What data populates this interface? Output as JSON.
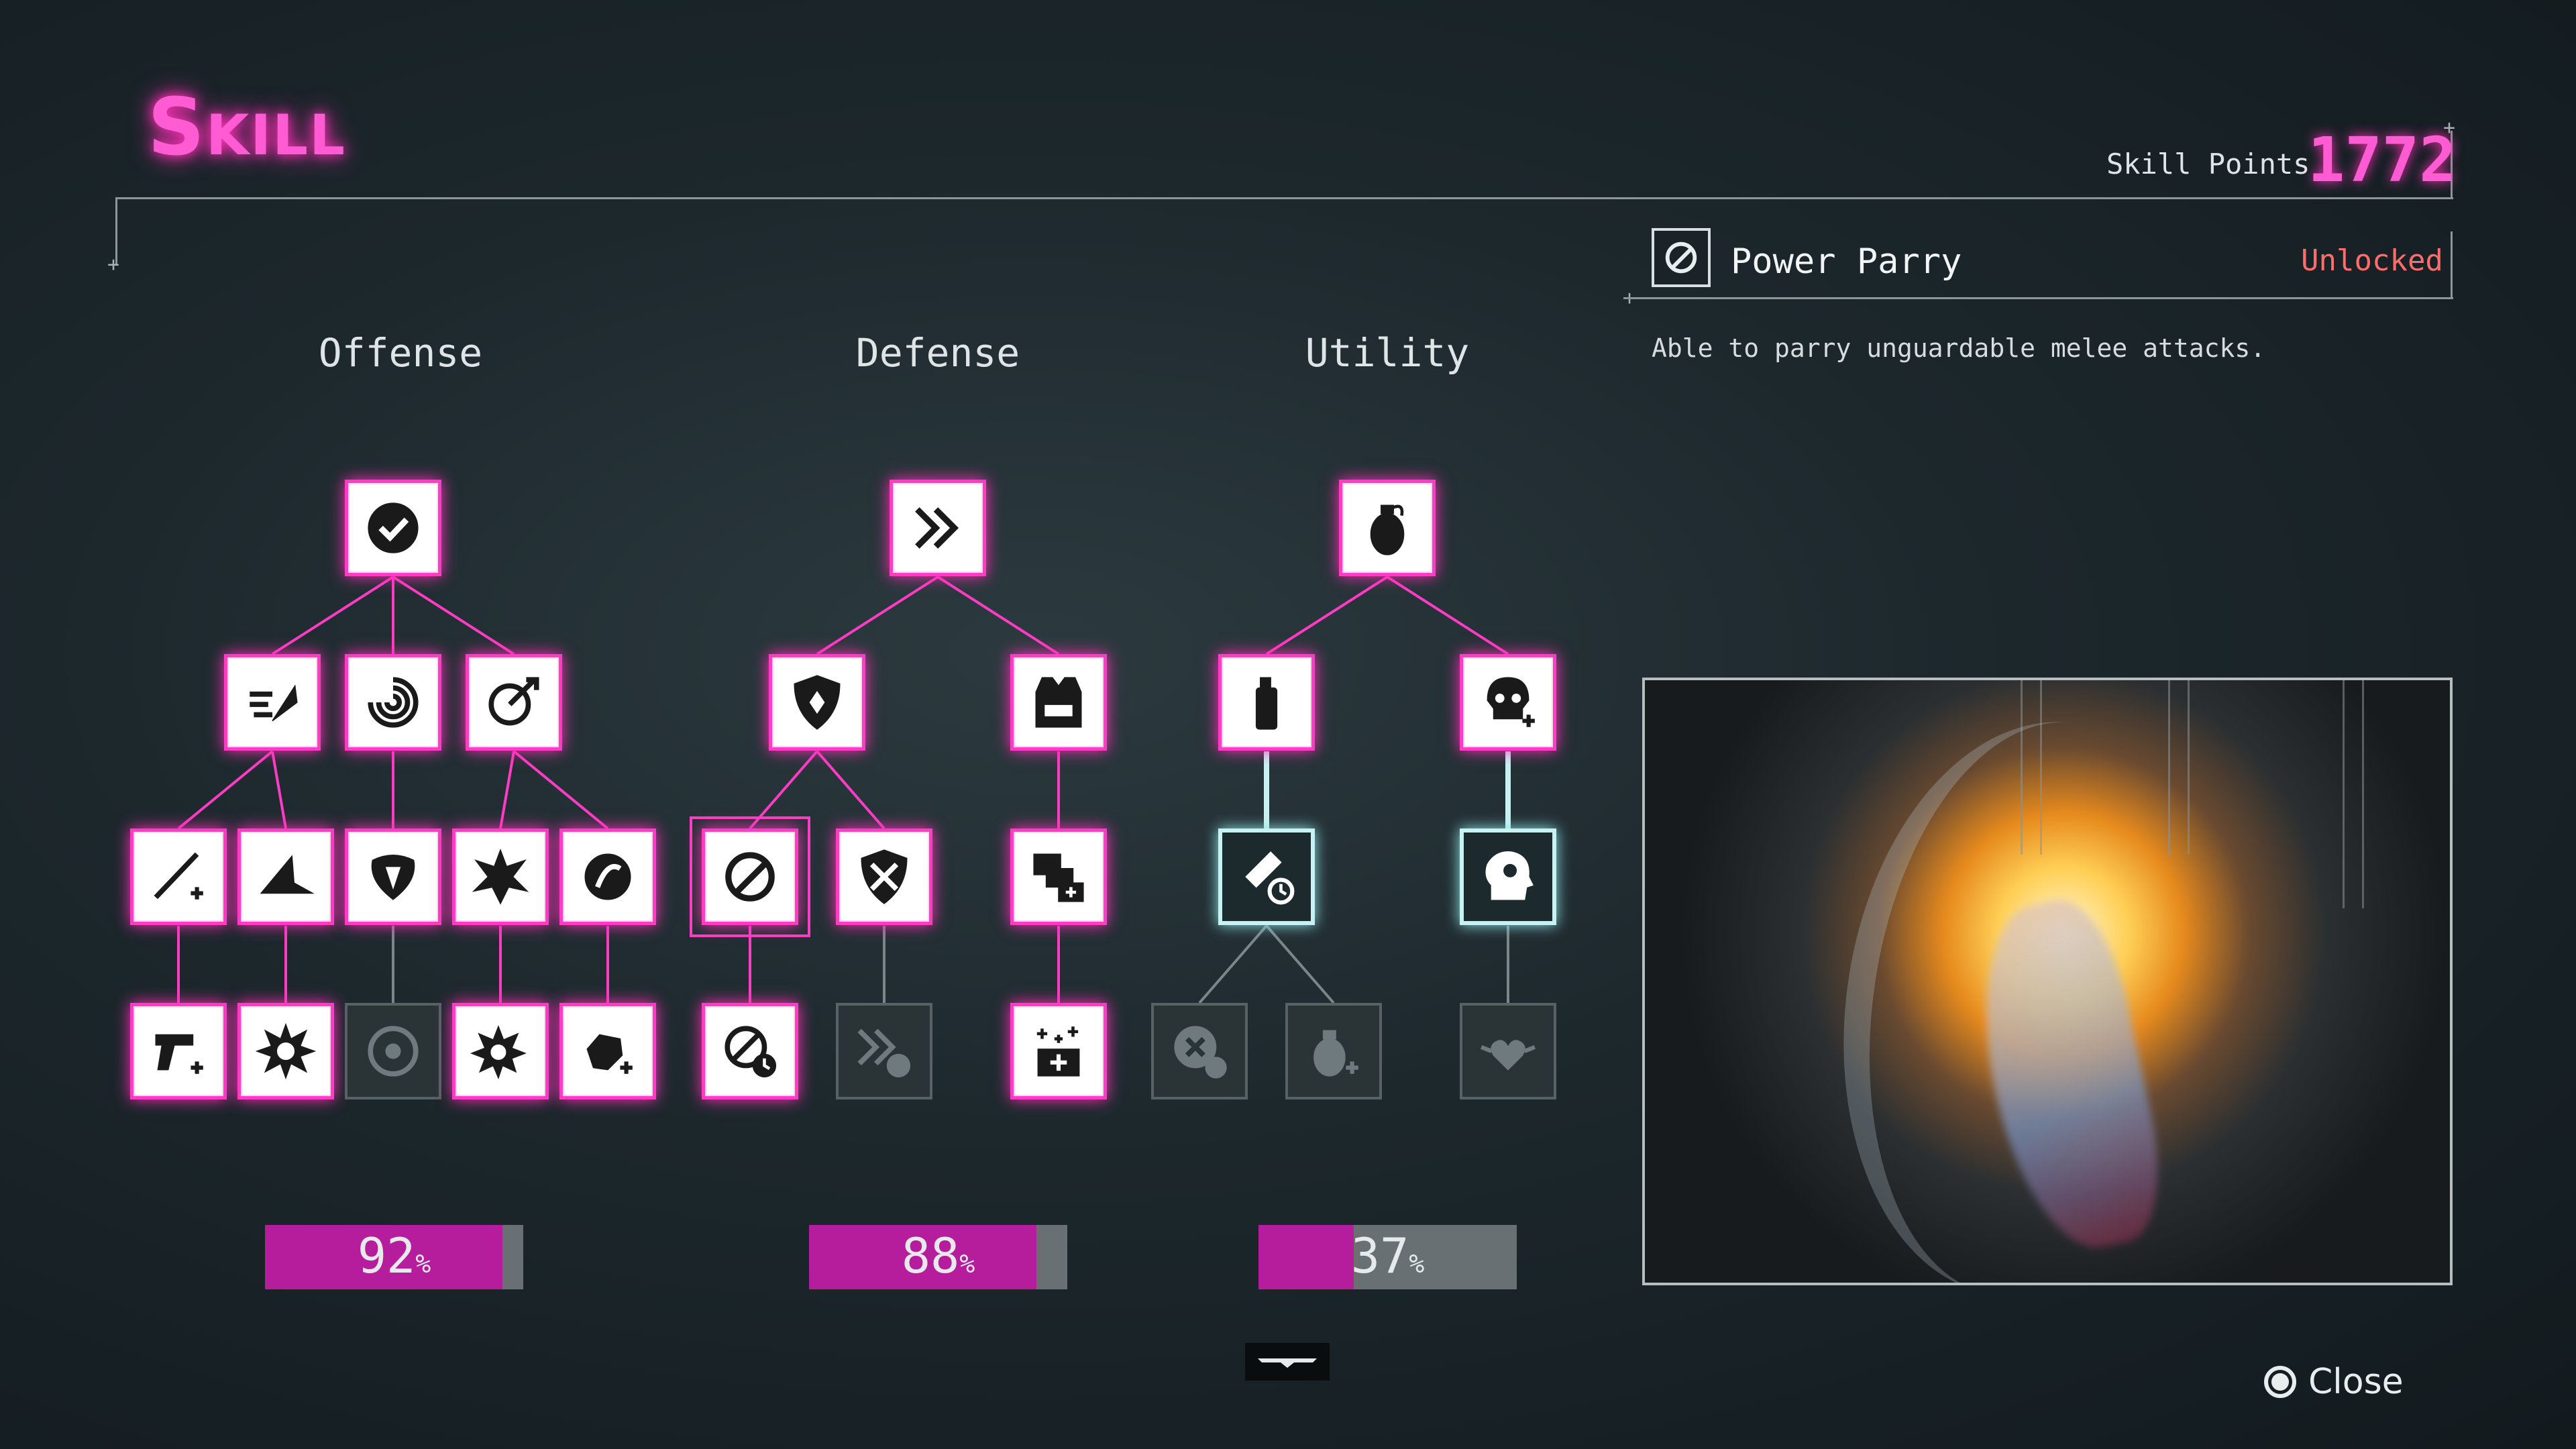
{
  "header": {
    "title": "Skill",
    "skill_points_label": "Skill Points",
    "skill_points_value": "1772"
  },
  "selected_skill": {
    "name": "Power Parry",
    "status": "Unlocked",
    "description": "Able to parry unguardable melee attacks.",
    "icon": "parry-icon"
  },
  "colors": {
    "accent": "#ff3cc4",
    "bar_fill": "#b51d9d",
    "status_unlocked": "#ff6c6c"
  },
  "categories": [
    {
      "name": "Offense",
      "completion": "92",
      "completion_fraction": 0.92,
      "unit": "%"
    },
    {
      "name": "Defense",
      "completion": "88",
      "completion_fraction": 0.88,
      "unit": "%"
    },
    {
      "name": "Utility",
      "completion": "37",
      "completion_fraction": 0.37,
      "unit": "%"
    }
  ],
  "skill_nodes": [
    {
      "id": "off-root",
      "icon": "checkmark-icon",
      "state": "on"
    },
    {
      "id": "off-a",
      "icon": "dash-slash-icon",
      "state": "on"
    },
    {
      "id": "off-b",
      "icon": "swirl-icon",
      "state": "on"
    },
    {
      "id": "off-c",
      "icon": "target-arrow-icon",
      "state": "on"
    },
    {
      "id": "off-a1",
      "icon": "sword-plus-icon",
      "state": "on"
    },
    {
      "id": "off-a2",
      "icon": "ground-slash-icon",
      "state": "on"
    },
    {
      "id": "off-b1",
      "icon": "claw-icon",
      "state": "on"
    },
    {
      "id": "off-c1",
      "icon": "burst-icon",
      "state": "on"
    },
    {
      "id": "off-c2",
      "icon": "fist-icon",
      "state": "on"
    },
    {
      "id": "off-a1a",
      "icon": "gun-plus-icon",
      "state": "on"
    },
    {
      "id": "off-a2a",
      "icon": "explosion-icon",
      "state": "on"
    },
    {
      "id": "off-b1a",
      "icon": "vortex-icon",
      "state": "off"
    },
    {
      "id": "off-c1a",
      "icon": "burst-plus-icon",
      "state": "on"
    },
    {
      "id": "off-c2a",
      "icon": "punch-plus-icon",
      "state": "on"
    },
    {
      "id": "def-root",
      "icon": "double-chevron-icon",
      "state": "on"
    },
    {
      "id": "def-a",
      "icon": "shield-icon",
      "state": "on"
    },
    {
      "id": "def-b",
      "icon": "vest-icon",
      "state": "on"
    },
    {
      "id": "def-a1",
      "icon": "parry-icon",
      "state": "cur"
    },
    {
      "id": "def-a2",
      "icon": "shield-swords-icon",
      "state": "on"
    },
    {
      "id": "def-b1",
      "icon": "medkit-stack-icon",
      "state": "on"
    },
    {
      "id": "def-a1a",
      "icon": "parry-clock-icon",
      "state": "on"
    },
    {
      "id": "def-a2a",
      "icon": "chevron-clock-icon",
      "state": "off"
    },
    {
      "id": "def-b1a",
      "icon": "medkit-sparkle-icon",
      "state": "on"
    },
    {
      "id": "uti-root",
      "icon": "grenade-icon",
      "state": "on"
    },
    {
      "id": "uti-a",
      "icon": "spray-can-icon",
      "state": "on"
    },
    {
      "id": "uti-b",
      "icon": "skull-plus-icon",
      "state": "on"
    },
    {
      "id": "uti-a1",
      "icon": "inhaler-clock-icon",
      "state": "sel"
    },
    {
      "id": "uti-b1",
      "icon": "head-target-icon",
      "state": "sel"
    },
    {
      "id": "uti-a1a",
      "icon": "cross-clock-icon",
      "state": "off"
    },
    {
      "id": "uti-a1b",
      "icon": "grenade-plus-icon",
      "state": "off"
    },
    {
      "id": "uti-b1a",
      "icon": "heart-wings-icon",
      "state": "off"
    }
  ],
  "footer": {
    "close_label": "Close",
    "logo_icon": "studio-logo-icon"
  }
}
